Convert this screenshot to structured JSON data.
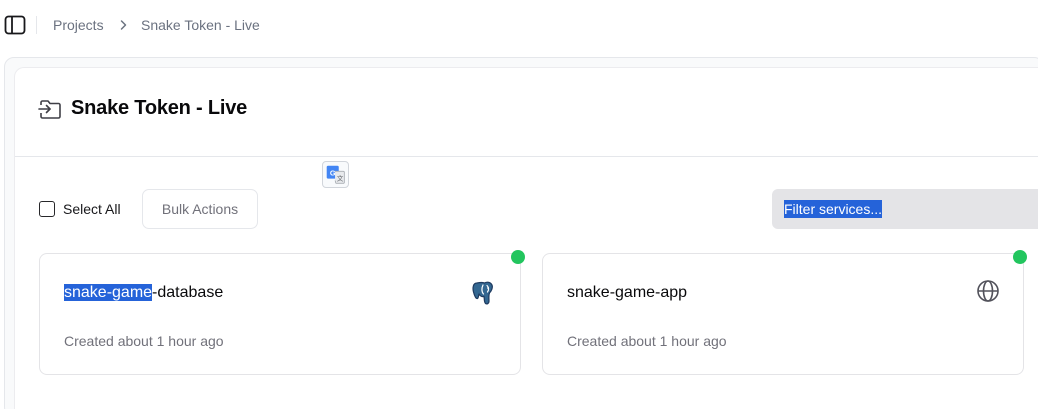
{
  "breadcrumb": {
    "items": [
      "Projects",
      "Snake Token - Live"
    ]
  },
  "project": {
    "title": "Snake Token - Live"
  },
  "toolbar": {
    "select_all_label": "Select All",
    "select_all_checked": false,
    "bulk_actions_label": "Bulk Actions",
    "filter_placeholder": "Filter services..."
  },
  "services": [
    {
      "name_highlight": "snake-game",
      "name_rest": "-database",
      "created": "Created about 1 hour ago",
      "status": "running",
      "status_color": "#22c55e",
      "icon": "postgresql-elephant-icon"
    },
    {
      "name": "snake-game-app",
      "created": "Created about 1 hour ago",
      "status": "running",
      "status_color": "#22c55e",
      "icon": "globe-icon"
    }
  ],
  "colors": {
    "selection_highlight": "#2563d9",
    "status_running": "#22c55e"
  }
}
